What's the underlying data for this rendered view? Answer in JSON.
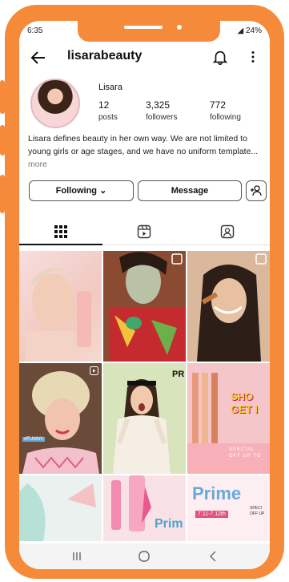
{
  "status_bar": {
    "time": "6:35",
    "battery": "24%",
    "signal_icons": "◦ ◦ ⊿"
  },
  "top_bar": {
    "username": "lisarabeauty"
  },
  "profile": {
    "display_name": "Lisara",
    "stats": [
      {
        "value": "12",
        "label": "posts"
      },
      {
        "value": "3,325",
        "label": "followers"
      },
      {
        "value": "772",
        "label": "following"
      }
    ],
    "bio": "Lisara defines beauty in her own way. We are not limited to young girls or age stages, and we have no uniform template...",
    "bio_more": "more"
  },
  "actions": {
    "following_label": "Following",
    "message_label": "Message"
  },
  "tabs": [
    "posts-grid",
    "reels",
    "tagged"
  ],
  "grid_overlay_text": {
    "shop_line1": "SHO",
    "shop_line2": "GET I",
    "special": "SPECIAL",
    "off_up_to": "OFF UP TO",
    "prime": "Prime",
    "prime_dates": "7.11-7.12th",
    "prime_side": "SPECI",
    "prime_side2": "OFF UP",
    "pr": "PR",
    "prime_short": "Prim",
    "funny": "#FUNNY"
  },
  "colors": {
    "device_frame": "#f58b3a",
    "text": "#111111",
    "pink": "#f6c1cf",
    "accent_pink": "#e84e8a"
  }
}
